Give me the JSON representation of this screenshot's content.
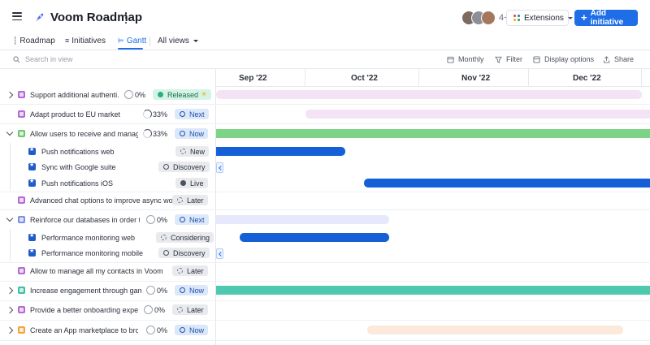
{
  "header": {
    "title": "Voom Roadmap",
    "avatars_more": "4+",
    "extensions_label": "Extensions",
    "add_label": "Add initiative",
    "accent": "#1e6ee8"
  },
  "tabs": [
    {
      "label": "Roadmap",
      "icon": "roadmap-icon"
    },
    {
      "label": "Initiatives",
      "icon": "list-icon"
    },
    {
      "label": "Gantt",
      "icon": "gantt-icon",
      "active": true
    },
    {
      "label": "All views",
      "icon": "chevron-down-icon"
    }
  ],
  "toolbar": {
    "search_placeholder": "Search in view",
    "monthly": "Monthly",
    "filter": "Filter",
    "display_options": "Display options",
    "share": "Share"
  },
  "months": [
    "Sep '22",
    "Oct '22",
    "Nov '22",
    "Dec '22"
  ],
  "rows": [
    {
      "text": "Support additional authenti...",
      "progress": "0%",
      "status": "Released"
    },
    {
      "text": "Adapt product to EU market",
      "progress": "33%",
      "status": "Next"
    },
    {
      "text": "Allow users to receive and manag...",
      "progress": "33%",
      "status": "Now"
    },
    {
      "text": "Push notifications web",
      "status": "New"
    },
    {
      "text": "Sync with Google suite",
      "status": "Discovery"
    },
    {
      "text": "Push notifications iOS",
      "status": "Live"
    },
    {
      "text": "Advanced chat options to improve async work",
      "status": "Later"
    },
    {
      "text": "Reinforce our databases in order to...",
      "progress": "0%",
      "status": "Next"
    },
    {
      "text": "Performance monitoring web",
      "status": "Considering"
    },
    {
      "text": "Performance monitoring mobile",
      "status": "Discovery"
    },
    {
      "text": "Allow to manage all my contacts in Voom",
      "status": "Later"
    },
    {
      "text": "Increase engagement through gami...",
      "progress": "0%",
      "status": "Now"
    },
    {
      "text": "Provide a better onboarding experi...",
      "progress": "0%",
      "status": "Later"
    },
    {
      "text": "Create an App marketplace to broa...",
      "progress": "0%",
      "status": "Now"
    }
  ],
  "colors": {
    "pink_light": "#f3e3f5",
    "green": "#7ed486",
    "blue": "#1560d6",
    "lavender": "#e6e8fb",
    "teal": "#4ec9b0",
    "peach": "#fbeadb"
  }
}
